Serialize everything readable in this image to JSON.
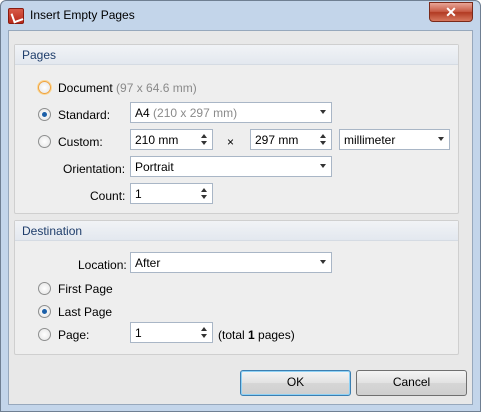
{
  "window": {
    "title": "Insert Empty Pages",
    "close_glyph": "✕"
  },
  "pages": {
    "header": "Pages",
    "document": {
      "label": "Document",
      "info": "(97 x 64.6 mm)"
    },
    "standard": {
      "label": "Standard:",
      "value_main": "A4",
      "value_sub": "(210 x 297 mm)"
    },
    "custom": {
      "label": "Custom:",
      "width": "210 mm",
      "times": "×",
      "height": "297 mm",
      "unit": "millimeter"
    },
    "orientation": {
      "label": "Orientation:",
      "value": "Portrait"
    },
    "count": {
      "label": "Count:",
      "value": "1"
    }
  },
  "destination": {
    "header": "Destination",
    "location": {
      "label": "Location:",
      "value": "After"
    },
    "first_page": "First Page",
    "last_page": "Last Page",
    "page": {
      "label": "Page:",
      "value": "1",
      "total_prefix": "(total ",
      "total_count": "1",
      "total_suffix": " pages)"
    }
  },
  "buttons": {
    "ok": "OK",
    "cancel": "Cancel"
  },
  "selection": {
    "pages_option": "standard",
    "destination_option": "last_page"
  }
}
